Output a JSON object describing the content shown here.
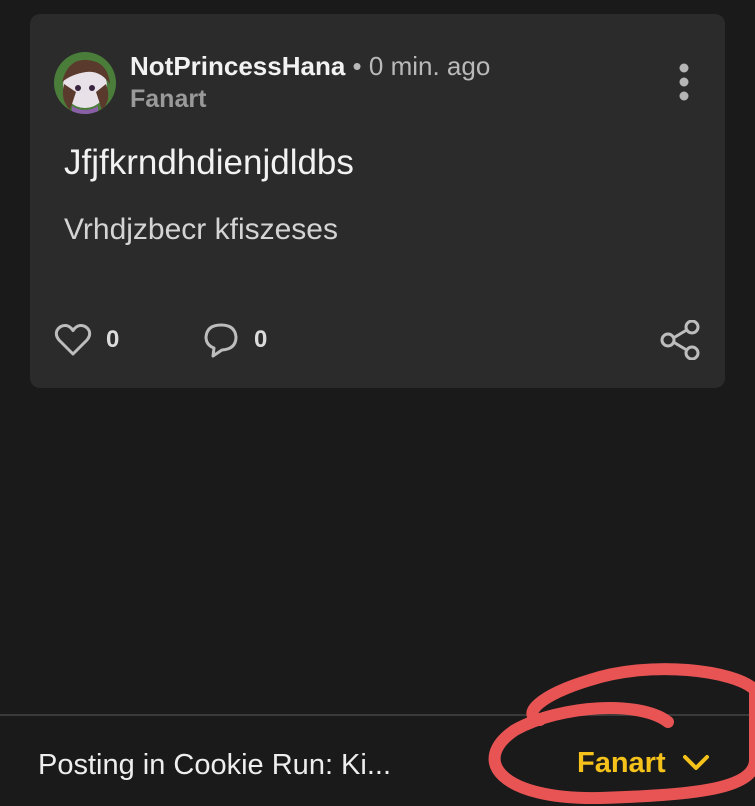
{
  "post": {
    "author": "NotPrincessHana",
    "separator": "•",
    "time": "0 min. ago",
    "category": "Fanart",
    "title": "Jfjfkrndhdienjdldbs",
    "body": "Vrhdjzbecr kfiszeses",
    "likes": "0",
    "comments": "0"
  },
  "bottom_bar": {
    "posting_in": "Posting in Cookie Run: Ki...",
    "category": "Fanart"
  },
  "colors": {
    "background": "#1a1a1a",
    "card": "#2b2b2b",
    "accent": "#f4c21a",
    "annotation": "#e85454"
  },
  "icons": [
    "heart-icon",
    "comment-icon",
    "share-icon",
    "more-vertical-icon",
    "chevron-down-icon"
  ]
}
